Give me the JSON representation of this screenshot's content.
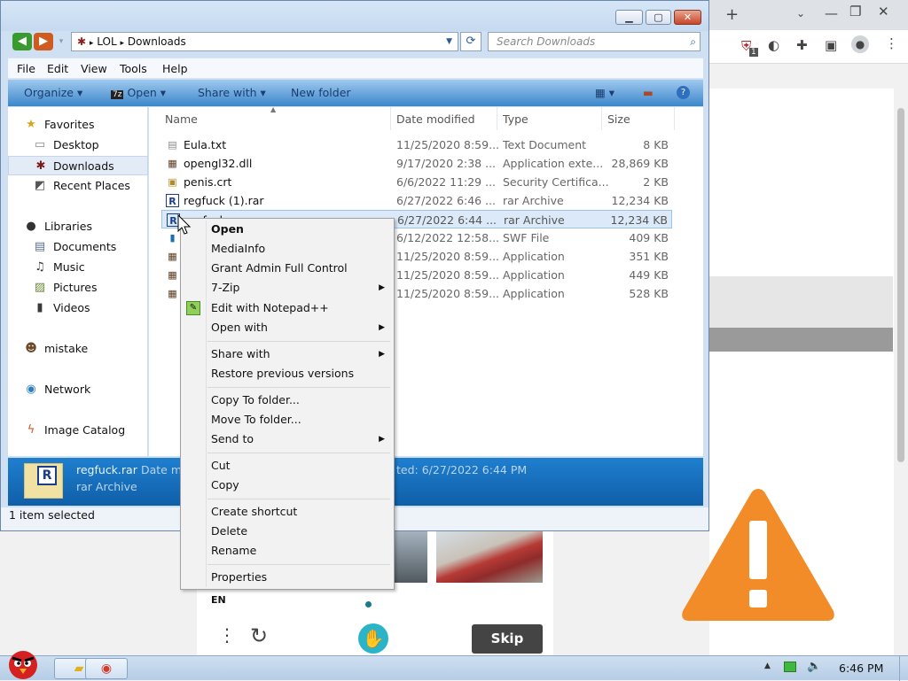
{
  "explorer": {
    "breadcrumb": [
      "LOL",
      "Downloads"
    ],
    "search_placeholder": "Search Downloads",
    "menu": [
      "File",
      "Edit",
      "View",
      "Tools",
      "Help"
    ],
    "commands": [
      "Organize",
      "Open",
      "Share with",
      "New folder"
    ],
    "nav": {
      "favorites": "Favorites",
      "desktop": "Desktop",
      "downloads": "Downloads",
      "recent": "Recent Places",
      "libraries": "Libraries",
      "documents": "Documents",
      "music": "Music",
      "pictures": "Pictures",
      "videos": "Videos",
      "mistake": "mistake",
      "network": "Network",
      "image_catalog": "Image Catalog"
    },
    "columns": [
      "Name",
      "Date modified",
      "Type",
      "Size"
    ],
    "files": [
      {
        "name": "Eula.txt",
        "date": "11/25/2020 8:59...",
        "type": "Text Document",
        "size": "8 KB"
      },
      {
        "name": "opengl32.dll",
        "date": "9/17/2020 2:38 ...",
        "type": "Application exte...",
        "size": "28,869 KB"
      },
      {
        "name": "penis.crt",
        "date": "6/6/2022 11:29 ...",
        "type": "Security Certifica...",
        "size": "2 KB"
      },
      {
        "name": "regfuck (1).rar",
        "date": "6/27/2022 6:46 ...",
        "type": "rar Archive",
        "size": "12,234 KB"
      },
      {
        "name": "regfuck.rar",
        "date": "6/27/2022 6:44 ...",
        "type": "rar Archive",
        "size": "12,234 KB"
      },
      {
        "name": "",
        "date": "6/12/2022 12:58...",
        "type": "SWF File",
        "size": "409 KB"
      },
      {
        "name": "",
        "date": "11/25/2020 8:59...",
        "type": "Application",
        "size": "351 KB"
      },
      {
        "name": "",
        "date": "11/25/2020 8:59...",
        "type": "Application",
        "size": "449 KB"
      },
      {
        "name": "",
        "date": "11/25/2020 8:59...",
        "type": "Application",
        "size": "528 KB"
      }
    ],
    "details": {
      "name": "regfuck.rar",
      "date_label": "Date m",
      "created": "ted: 6/27/2022 6:44 PM",
      "type": "rar Archive"
    },
    "status": "1 item selected"
  },
  "context_menu": {
    "open": "Open",
    "mediainfo": "MediaInfo",
    "grant": "Grant Admin Full Control",
    "zip": "7-Zip",
    "notepad": "Edit with Notepad++",
    "open_with": "Open with",
    "share_with": "Share with",
    "restore": "Restore previous versions",
    "copy_to": "Copy To folder...",
    "move_to": "Move To folder...",
    "send_to": "Send to",
    "cut": "Cut",
    "copy": "Copy",
    "create_shortcut": "Create shortcut",
    "delete": "Delete",
    "rename": "Rename",
    "properties": "Properties"
  },
  "browser_page": {
    "lang": "EN",
    "skip": "Skip",
    "extension_badge": "1"
  },
  "taskbar": {
    "clock": "6:46 PM"
  },
  "colors": {
    "warning": "#f28c28",
    "selection": "#dbe9f8",
    "details_bar": "#1570c0"
  }
}
